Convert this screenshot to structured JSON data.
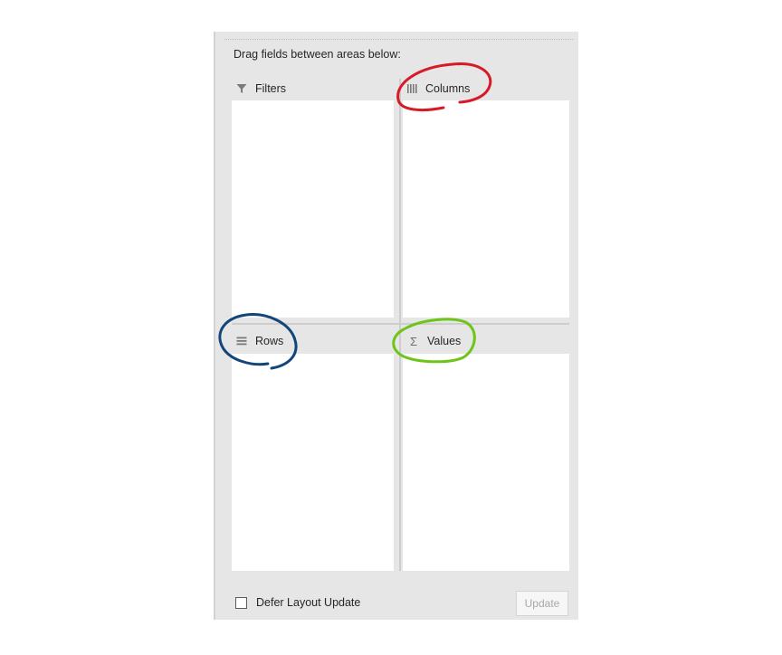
{
  "panel": {
    "instructions": "Drag fields between areas below:"
  },
  "areas": {
    "filters": {
      "label": "Filters",
      "icon": "filter-icon"
    },
    "columns": {
      "label": "Columns",
      "icon": "columns-icon"
    },
    "rows": {
      "label": "Rows",
      "icon": "rows-icon"
    },
    "values": {
      "label": "Values",
      "icon": "sigma-icon"
    }
  },
  "footer": {
    "defer_label": "Defer Layout Update",
    "defer_checked": false,
    "update_label": "Update",
    "update_enabled": false
  },
  "annotation_colors": {
    "columns": "#d61a27",
    "rows": "#12457a",
    "values": "#6fc41a"
  }
}
